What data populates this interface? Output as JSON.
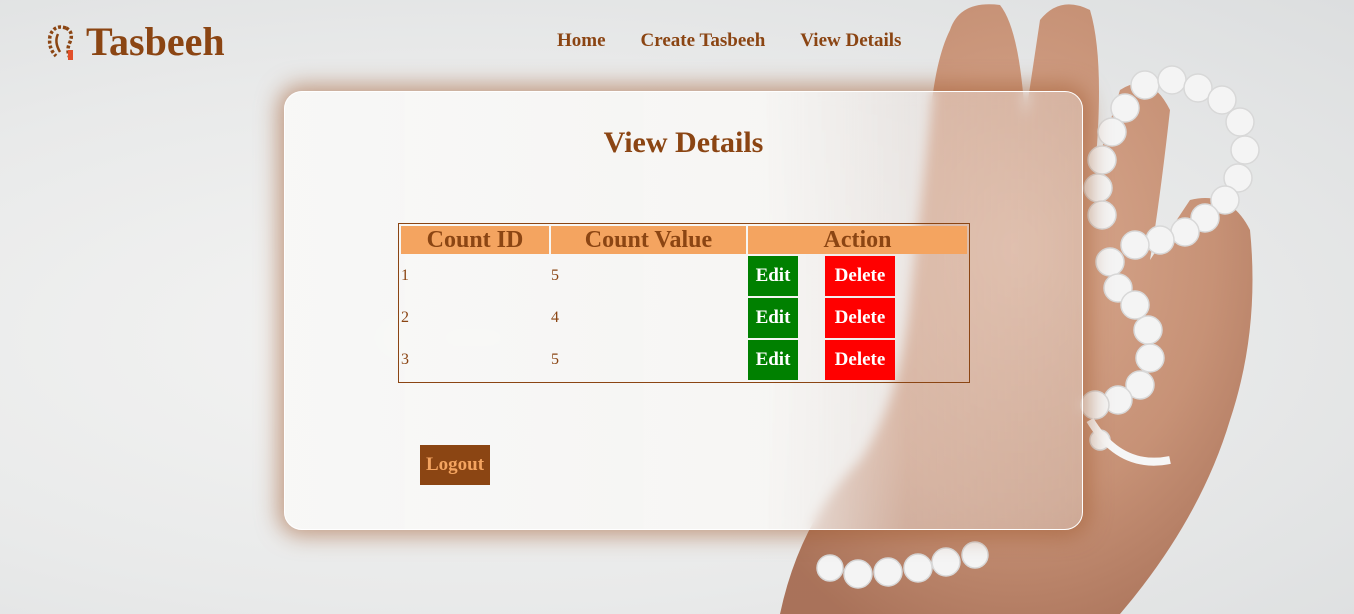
{
  "brand": {
    "title": "Tasbeeh",
    "icon": "tasbeeh-beads-icon"
  },
  "nav": {
    "home": "Home",
    "create": "Create Tasbeeh",
    "view": "View Details"
  },
  "page": {
    "title": "View Details"
  },
  "table": {
    "headers": {
      "id": "Count ID",
      "value": "Count Value",
      "action": "Action"
    },
    "rows": [
      {
        "id": "1",
        "value": "5",
        "edit": "Edit",
        "delete": "Delete"
      },
      {
        "id": "2",
        "value": "4",
        "edit": "Edit",
        "delete": "Delete"
      },
      {
        "id": "3",
        "value": "5",
        "edit": "Edit",
        "delete": "Delete"
      }
    ]
  },
  "logout": "Logout",
  "colors": {
    "brand": "#8b4513",
    "header_bg": "#f4a460",
    "edit": "#008000",
    "delete": "#ff0000"
  }
}
